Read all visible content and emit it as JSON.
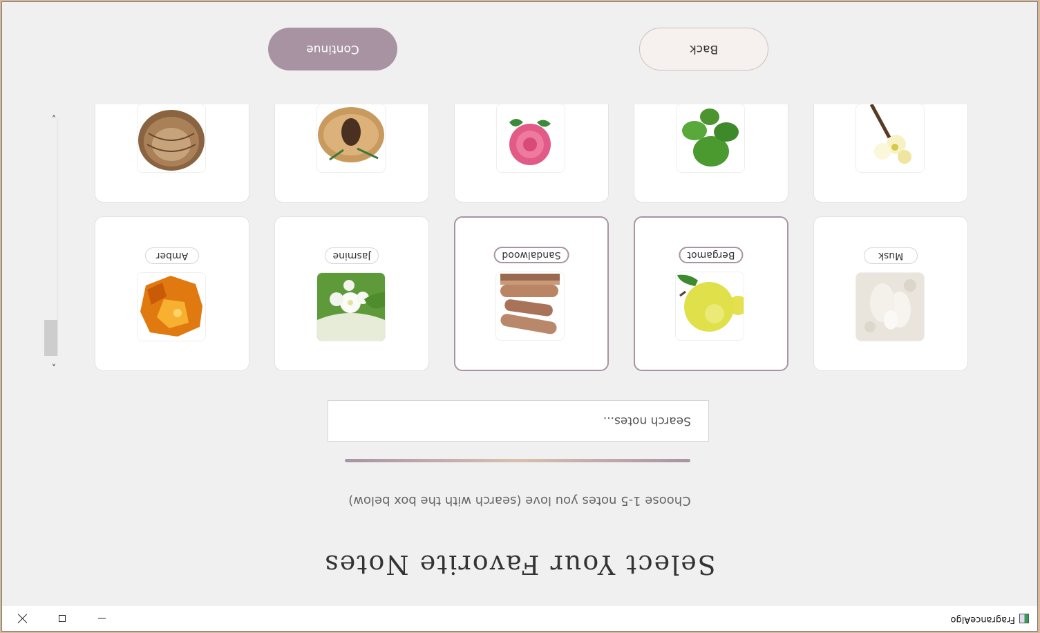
{
  "window": {
    "title": "FragranceAlgo"
  },
  "header": {
    "title": "Select Your Favorite Notes",
    "subtitle": "Choose 1-5 notes you love (search with the box below)"
  },
  "search": {
    "placeholder": "Search notes...",
    "value": ""
  },
  "notes": [
    {
      "label": "Musk",
      "selected": false,
      "image": "musk-icon"
    },
    {
      "label": "Bergamot",
      "selected": true,
      "image": "bergamot-icon"
    },
    {
      "label": "Sandalwood",
      "selected": true,
      "image": "sandalwood-icon"
    },
    {
      "label": "Jasmine",
      "selected": false,
      "image": "jasmine-icon"
    },
    {
      "label": "Amber",
      "selected": false,
      "image": "amber-icon"
    },
    {
      "label": "",
      "selected": false,
      "image": "vanilla-icon"
    },
    {
      "label": "",
      "selected": false,
      "image": "mint-icon"
    },
    {
      "label": "",
      "selected": false,
      "image": "rose-icon"
    },
    {
      "label": "",
      "selected": false,
      "image": "pine-icon"
    },
    {
      "label": "",
      "selected": false,
      "image": "oud-icon"
    }
  ],
  "buttons": {
    "back": "Back",
    "continue": "Continue"
  },
  "colors": {
    "accent": "#a893a2",
    "background": "#f0f0f0",
    "back_button": "#f6f1ee"
  },
  "scroll": {
    "position_fraction": 0.0
  }
}
